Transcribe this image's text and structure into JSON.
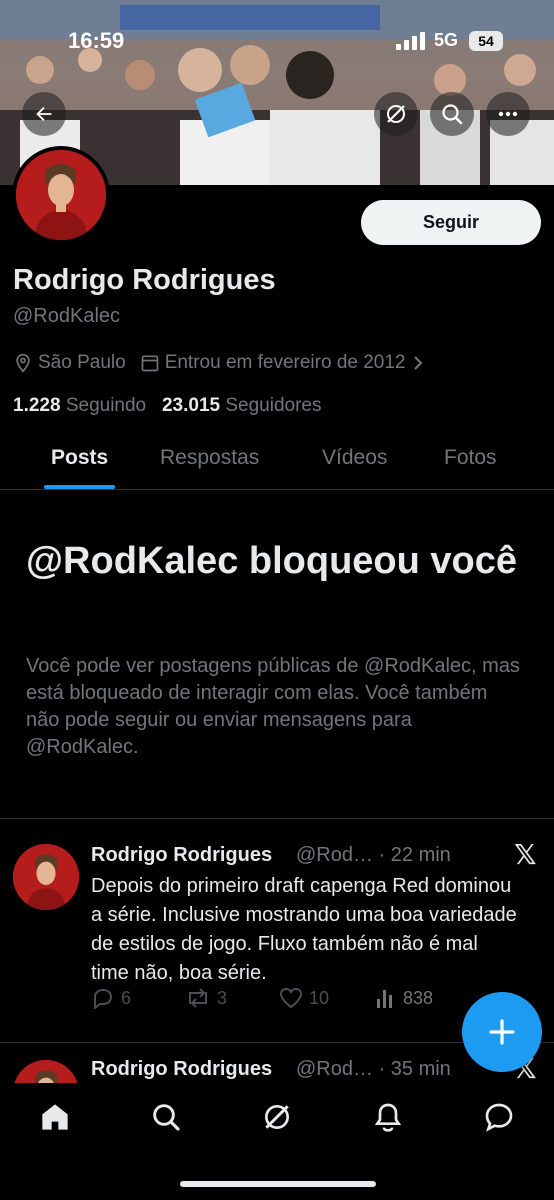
{
  "status_bar": {
    "time": "16:59",
    "network": "5G",
    "battery": "54"
  },
  "profile": {
    "name": "Rodrigo Rodrigues",
    "handle": "@RodKalec",
    "location": "São Paulo",
    "joined": "Entrou em fevereiro de 2012",
    "following_count": "1.228",
    "following_label": "Seguindo",
    "followers_count": "23.015",
    "followers_label": "Seguidores",
    "follow_button": "Seguir"
  },
  "tabs": [
    {
      "label": "Posts",
      "active": true
    },
    {
      "label": "Respostas",
      "active": false
    },
    {
      "label": "Vídeos",
      "active": false
    },
    {
      "label": "Fotos",
      "active": false
    }
  ],
  "blocked": {
    "title": "@RodKalec bloqueou você",
    "message": "Você pode ver postagens públicas de @RodKalec, mas está bloqueado de interagir com elas. Você também não pode seguir ou enviar mensagens para @RodKalec."
  },
  "posts": [
    {
      "name": "Rodrigo Rodrigues",
      "handle_time": "@Rod… · 22 min",
      "text": "Depois do primeiro draft capenga Red dominou a série. Inclusive mostrando uma boa variedade de estilos de jogo. Fluxo também não é mal time não, boa série.",
      "replies": "6",
      "reposts": "3",
      "likes": "10",
      "views": "838"
    },
    {
      "name": "Rodrigo Rodrigues",
      "handle_time": "@Rod… · 35 min"
    }
  ],
  "colors": {
    "accent": "#1d9bf0",
    "background": "#000000",
    "muted": "#71767b",
    "text": "#e7e9ea"
  },
  "icons": {
    "nav": [
      "home-icon",
      "search-icon",
      "grok-icon",
      "notifications-icon",
      "messages-icon"
    ],
    "header": [
      "back-arrow-icon",
      "grok-icon",
      "search-icon",
      "more-icon"
    ]
  }
}
